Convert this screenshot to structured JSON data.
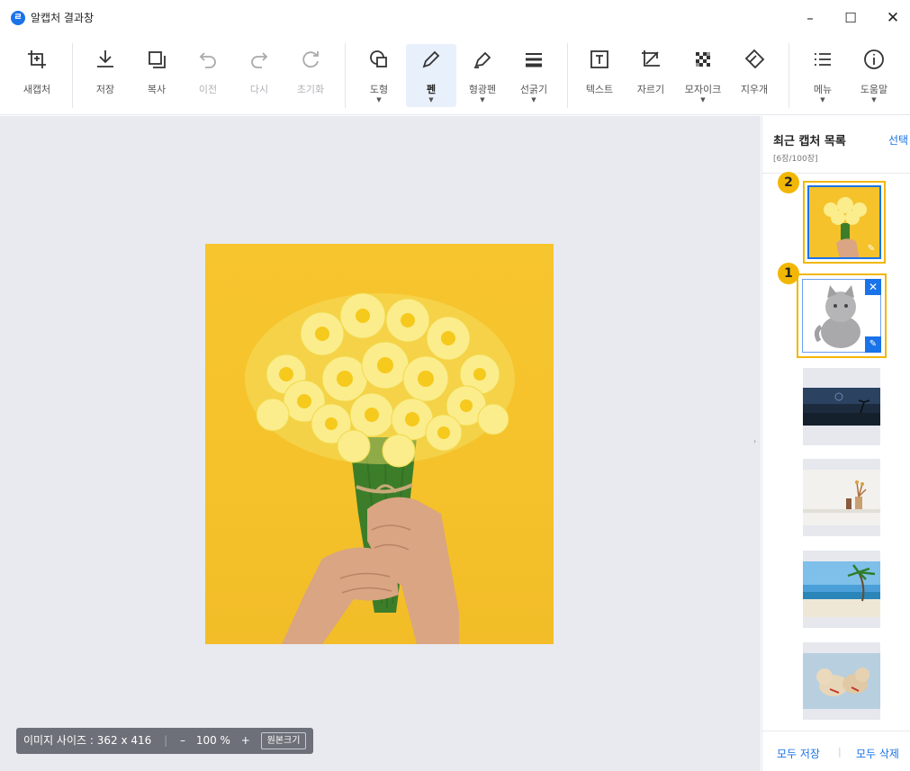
{
  "window": {
    "title": "알캡처 결과창",
    "controls": {
      "minimize": "–",
      "maximize": "☐",
      "close": "✕"
    }
  },
  "toolbar": {
    "new_capture": "새캡처",
    "save": "저장",
    "copy": "복사",
    "undo": "이전",
    "redo": "다시",
    "reset": "초기화",
    "shape": "도형",
    "pen": "펜",
    "highlighter": "형광펜",
    "line_width": "선굵기",
    "text": "텍스트",
    "crop": "자르기",
    "mosaic": "모자이크",
    "eraser": "지우개",
    "menu": "메뉴",
    "help": "도움말",
    "dropdown_arrow": "▼"
  },
  "statusbar": {
    "image_size_label": "이미지 사이즈 : 362 x 416",
    "zoom_out": "–",
    "zoom_value": "100 %",
    "zoom_in": "+",
    "original_size": "원본크기"
  },
  "sidebar": {
    "title": "최근 캡처 목록",
    "select": "선택",
    "count": "[6장/100장]",
    "badge_2": "2",
    "badge_1": "1",
    "save_all": "모두 저장",
    "separator": "|",
    "delete_all": "모두 삭제",
    "collapse_arrow": "›"
  },
  "colors": {
    "accent": "#1a73e8",
    "badge": "#f2b705",
    "canvas_bg": "#e8eaf0",
    "image_bg": "#f5c22b"
  }
}
